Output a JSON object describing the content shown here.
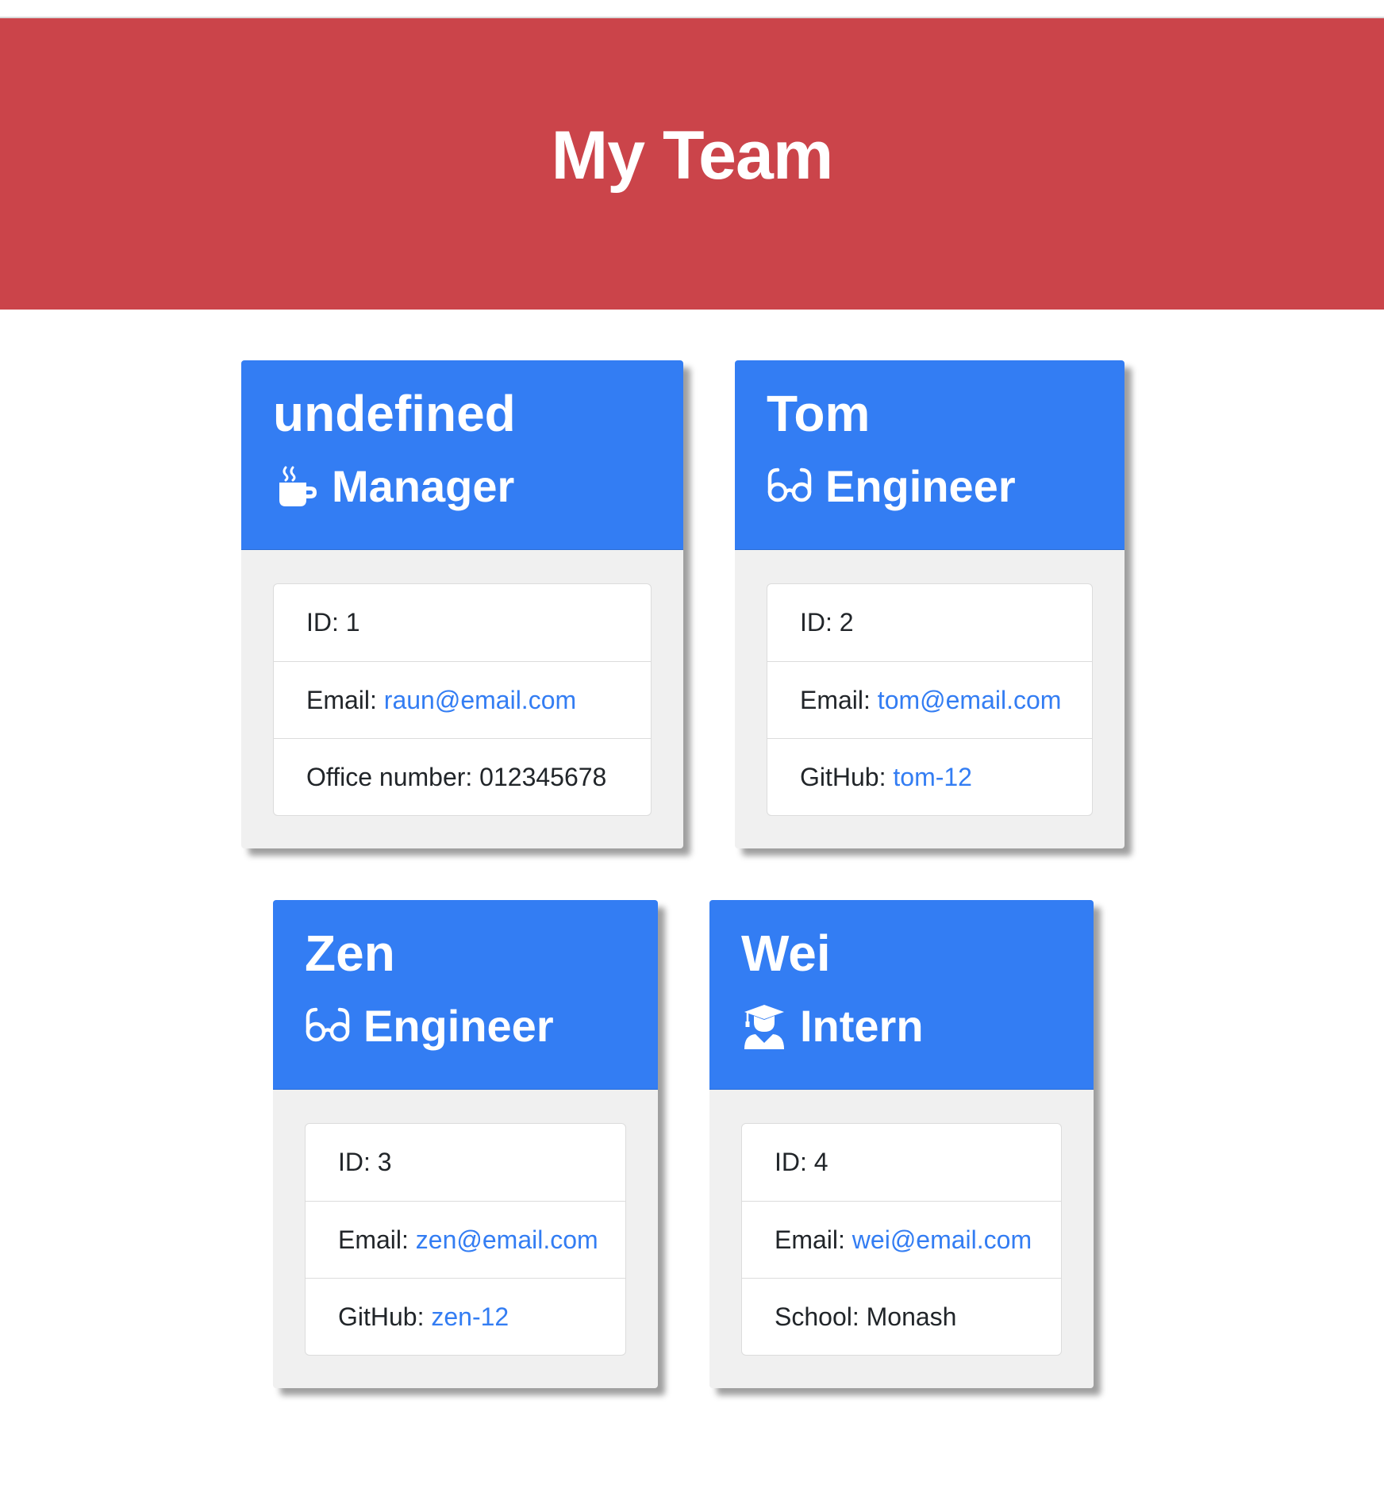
{
  "page": {
    "title": "My Team"
  },
  "colors": {
    "banner": "#cb444a",
    "card_header": "#337df3",
    "card_body": "#f0f0f0",
    "link": "#337df3"
  },
  "team": [
    {
      "name": "undefined",
      "role": "Manager",
      "icon": "coffee-mug-icon",
      "id_label": "ID: 1",
      "email_label": "Email: ",
      "email": "raun@email.com",
      "extra_label": "Office number: 012345678",
      "extra_link": ""
    },
    {
      "name": "Tom",
      "role": "Engineer",
      "icon": "glasses-icon",
      "id_label": "ID: 2",
      "email_label": "Email: ",
      "email": "tom@email.com",
      "extra_label": "GitHub: ",
      "extra_link": "tom-12"
    },
    {
      "name": "Zen",
      "role": "Engineer",
      "icon": "glasses-icon",
      "id_label": "ID: 3",
      "email_label": "Email: ",
      "email": "zen@email.com",
      "extra_label": "GitHub: ",
      "extra_link": "zen-12"
    },
    {
      "name": "Wei",
      "role": "Intern",
      "icon": "graduate-icon",
      "id_label": "ID: 4",
      "email_label": "Email: ",
      "email": "wei@email.com",
      "extra_label": "School: Monash",
      "extra_link": ""
    }
  ]
}
